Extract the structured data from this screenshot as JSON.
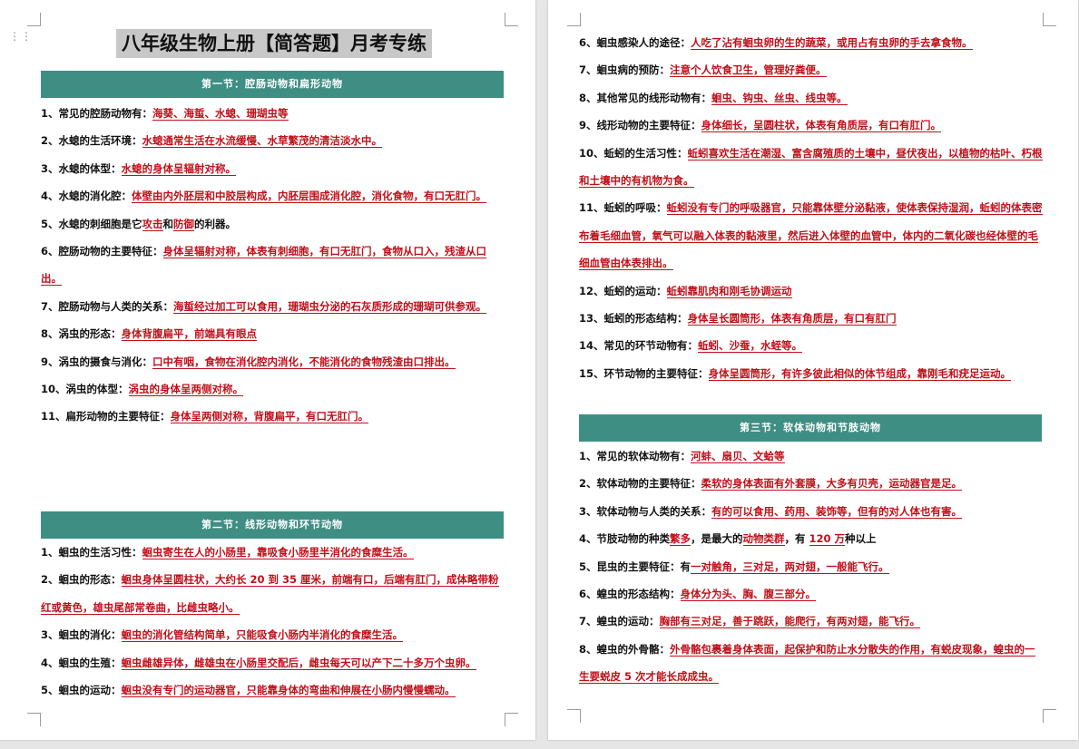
{
  "title": "八年级生物上册【简答题】月考专练",
  "sections": [
    {
      "header": "第一节：腔肠动物和扁形动物",
      "items": [
        {
          "parts": [
            {
              "t": "1、常见的腔肠动物有：",
              "a": false
            },
            {
              "t": "海葵、海蜇、水螅、珊瑚虫等",
              "a": true
            }
          ]
        },
        {
          "parts": [
            {
              "t": "2、水螅的生活环境：",
              "a": false
            },
            {
              "t": "水螅通常生活在水流缓慢、水草繁茂的清洁淡水中。",
              "a": true
            }
          ]
        },
        {
          "parts": [
            {
              "t": "3、水螅的体型：",
              "a": false
            },
            {
              "t": "水螅的身体呈辐射对称。",
              "a": true
            }
          ]
        },
        {
          "parts": [
            {
              "t": "4、水螅的消化腔：",
              "a": false
            },
            {
              "t": "体壁由内外胚层和中胶层构成，内胚层围成消化腔，消化食物，有口无肛门。",
              "a": true
            }
          ]
        },
        {
          "parts": [
            {
              "t": "5、水螅的刺细胞是它",
              "a": false
            },
            {
              "t": "攻击",
              "a": true
            },
            {
              "t": "和",
              "a": false
            },
            {
              "t": "防御",
              "a": true
            },
            {
              "t": "的利器。",
              "a": false
            }
          ]
        },
        {
          "parts": [
            {
              "t": "6、腔肠动物的主要特征：",
              "a": false
            },
            {
              "t": "身体呈辐射对称，体表有刺细胞，有口无肛门，食物从口入，残渣从口出。",
              "a": true
            }
          ]
        },
        {
          "parts": [
            {
              "t": "7、腔肠动物与人类的关系：",
              "a": false
            },
            {
              "t": "海蜇经过加工可以食用，珊瑚虫分泌的石灰质形成的珊瑚可供参观。",
              "a": true
            }
          ]
        },
        {
          "parts": [
            {
              "t": "8、涡虫的形态：",
              "a": false
            },
            {
              "t": "身体背腹扁平，前端具有眼点",
              "a": true
            }
          ]
        },
        {
          "parts": [
            {
              "t": "9、涡虫的摄食与消化：",
              "a": false
            },
            {
              "t": "口中有咽，食物在消化腔内消化，不能消化的食物残渣由口排出。",
              "a": true
            }
          ]
        },
        {
          "parts": [
            {
              "t": "10、涡虫的体型：",
              "a": false
            },
            {
              "t": "涡虫的身体呈两侧对称。",
              "a": true
            }
          ]
        },
        {
          "parts": [
            {
              "t": "11、扁形动物的主要特征：",
              "a": false
            },
            {
              "t": "身体呈两侧对称，背腹扁平，有口无肛门。",
              "a": true
            }
          ]
        }
      ]
    },
    {
      "header": "第二节：线形动物和环节动物",
      "items": [
        {
          "parts": [
            {
              "t": "1、蛔虫的生活习性：",
              "a": false
            },
            {
              "t": "蛔虫寄生在人的小肠里，靠吸食小肠里半消化的食糜生活。",
              "a": true
            }
          ]
        },
        {
          "parts": [
            {
              "t": "2、蛔虫的形态：",
              "a": false
            },
            {
              "t": "蛔虫身体呈圆柱状，大约长 20 到 35 厘米，前端有口，后端有肛门，成体略带粉红或黄色，雄虫尾部常卷曲，比雌虫略小。",
              "a": true
            }
          ]
        },
        {
          "parts": [
            {
              "t": "3、蛔虫的消化：",
              "a": false
            },
            {
              "t": "蛔虫的消化管结构简单，只能吸食小肠内半消化的食糜生活。",
              "a": true
            }
          ]
        },
        {
          "parts": [
            {
              "t": "4、蛔虫的生殖：",
              "a": false
            },
            {
              "t": "蛔虫雌雄异体，雌雄虫在小肠里交配后，雌虫每天可以产下二十多万个虫卵。",
              "a": true
            }
          ]
        },
        {
          "parts": [
            {
              "t": "5、蛔虫的运动：",
              "a": false
            },
            {
              "t": "蛔虫没有专门的运动器官，只能靠身体的弯曲和伸展在小肠内慢慢蠕动。",
              "a": true
            }
          ]
        }
      ]
    },
    {
      "header": "",
      "items": [
        {
          "parts": [
            {
              "t": "6、蛔虫感染人的途径：",
              "a": false
            },
            {
              "t": "人吃了沾有蛔虫卵的生的蔬菜，或用占有虫卵的手去拿食物。",
              "a": true
            }
          ]
        },
        {
          "parts": [
            {
              "t": "7、蛔虫病的预防：",
              "a": false
            },
            {
              "t": "注意个人饮食卫生，管理好粪便。",
              "a": true
            }
          ]
        },
        {
          "parts": [
            {
              "t": "8、其他常见的线形动物有：",
              "a": false
            },
            {
              "t": "蛔虫、钩虫、丝虫、线虫等。",
              "a": true
            }
          ]
        },
        {
          "parts": [
            {
              "t": "9、线形动物的主要特征：",
              "a": false
            },
            {
              "t": "身体细长，呈圆柱状，体表有角质层，有口有肛门。",
              "a": true
            }
          ]
        },
        {
          "parts": [
            {
              "t": "10、蚯蚓的生活习性：",
              "a": false
            },
            {
              "t": "蚯蚓喜欢生活在潮湿、富含腐殖质的土壤中，昼伏夜出，以植物的枯叶、朽根和土壤中的有机物为食。",
              "a": true
            }
          ]
        },
        {
          "parts": [
            {
              "t": "11、蚯蚓的呼吸：",
              "a": false
            },
            {
              "t": "蚯蚓没有专门的呼吸器官，只能靠体壁分泌黏液，使体表保持湿润，蚯蚓的体表密布着毛细血管，氧气可以融入体表的黏液里，然后进入体壁的血管中，体内的二氧化碳也经体壁的毛细血管由体表排出。",
              "a": true
            }
          ]
        },
        {
          "parts": [
            {
              "t": "12、蚯蚓的运动：",
              "a": false
            },
            {
              "t": "蚯蚓靠肌肉和刚毛协调运动",
              "a": true
            }
          ]
        },
        {
          "parts": [
            {
              "t": "13、蚯蚓的形态结构：",
              "a": false
            },
            {
              "t": "身体呈长圆筒形，体表有角质层，有口有肛门",
              "a": true
            }
          ]
        },
        {
          "parts": [
            {
              "t": "14、常见的环节动物有：",
              "a": false
            },
            {
              "t": "蚯蚓、沙蚕，水蛭等。",
              "a": true
            }
          ]
        },
        {
          "parts": [
            {
              "t": "15、环节动物的主要特征：",
              "a": false
            },
            {
              "t": "身体呈圆筒形，有许多彼此相似的体节组成，靠刚毛和疣足运动。",
              "a": true
            }
          ]
        }
      ]
    },
    {
      "header": "第三节：软体动物和节肢动物",
      "items": [
        {
          "parts": [
            {
              "t": "1、常见的软体动物有：",
              "a": false
            },
            {
              "t": "河蚌、扇贝、文蛤等",
              "a": true
            }
          ]
        },
        {
          "parts": [
            {
              "t": "2、软体动物的主要特征：",
              "a": false
            },
            {
              "t": "柔软的身体表面有外套膜，大多有贝壳，运动器官是足。",
              "a": true
            }
          ]
        },
        {
          "parts": [
            {
              "t": "3、软体动物与人类的关系：",
              "a": false
            },
            {
              "t": "有的可以食用、药用、装饰等，但有的对人体也有害。",
              "a": true
            }
          ]
        },
        {
          "parts": [
            {
              "t": "4、节肢动物的种类",
              "a": false
            },
            {
              "t": "繁多",
              "a": true
            },
            {
              "t": "，是最大的",
              "a": false
            },
            {
              "t": "动物类群",
              "a": true
            },
            {
              "t": "，有 ",
              "a": false
            },
            {
              "t": "120 万",
              "a": true
            },
            {
              "t": "种以上",
              "a": false
            }
          ]
        },
        {
          "parts": [
            {
              "t": "5、昆虫的主要特征：有",
              "a": false
            },
            {
              "t": "一对触角，三对足，两对翅，一般能飞行。",
              "a": true
            }
          ]
        },
        {
          "parts": [
            {
              "t": "6、蝗虫的形态结构：",
              "a": false
            },
            {
              "t": "身体分为头、胸、腹三部分。",
              "a": true
            }
          ]
        },
        {
          "parts": [
            {
              "t": "7、蝗虫的运动：",
              "a": false
            },
            {
              "t": "胸部有三对足，善于跳跃，能爬行，有两对翅，能飞行。",
              "a": true
            }
          ]
        },
        {
          "parts": [
            {
              "t": "8、蝗虫的外骨骼：",
              "a": false
            },
            {
              "t": "外骨骼包裹着身体表面，起保护和防止水分散失的作用，有蜕皮现象，蝗虫的一生要蜕皮 5 次才能长成成虫。",
              "a": true
            }
          ]
        }
      ]
    }
  ]
}
